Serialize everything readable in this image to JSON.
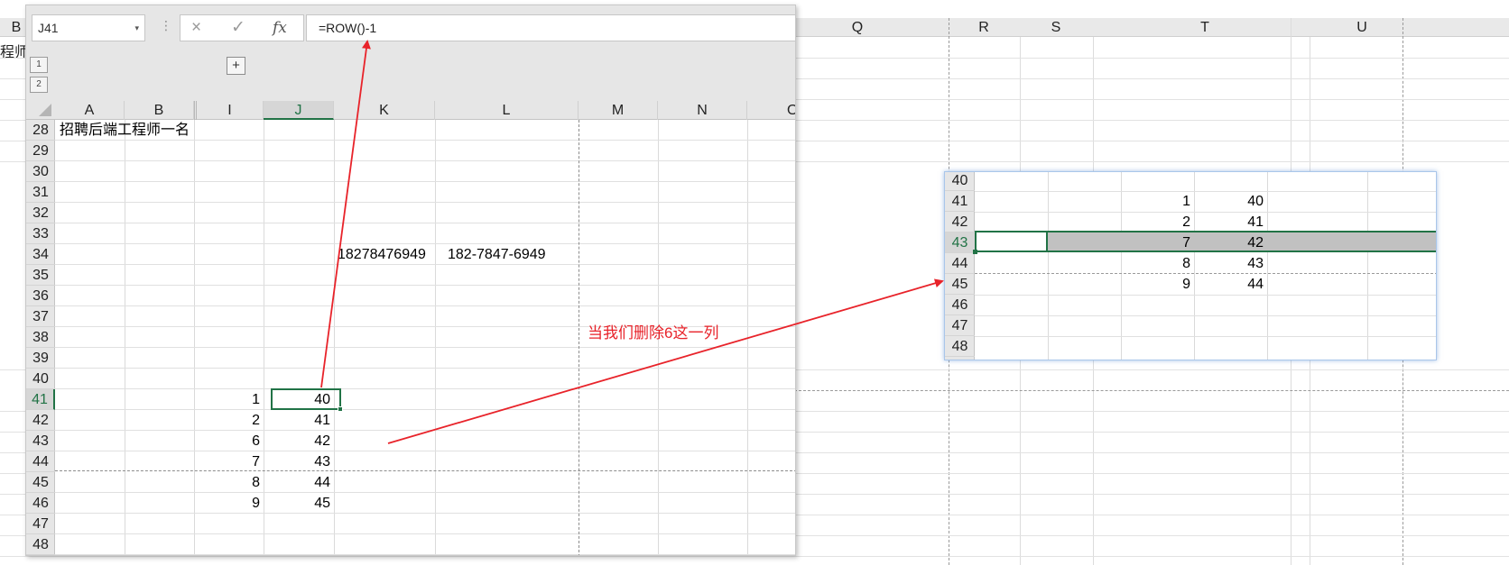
{
  "background_sheet": {
    "col_labels": [
      "B",
      "Q",
      "R",
      "S",
      "T",
      "U"
    ],
    "left_text": "程师"
  },
  "window": {
    "name_box": "J41",
    "formula": "=ROW()-1",
    "icons": {
      "cancel": "×",
      "enter": "✓",
      "fx": "fx",
      "dropdown": "▾",
      "dots": "⋮"
    },
    "outline_levels": [
      "1",
      "2"
    ],
    "expand_button": "+",
    "columns": [
      "A",
      "B",
      "I",
      "J",
      "K",
      "L",
      "M",
      "N",
      "O"
    ],
    "rows": [
      "28",
      "29",
      "30",
      "31",
      "32",
      "33",
      "34",
      "35",
      "36",
      "37",
      "38",
      "39",
      "40",
      "41",
      "42",
      "43",
      "44",
      "45",
      "46",
      "47",
      "48"
    ],
    "cells": {
      "a28": "招聘后端工程师一名",
      "k34": "18278476949",
      "l34": "182-7847-6949",
      "i": [
        "1",
        "2",
        "6",
        "7",
        "8",
        "9"
      ],
      "j": [
        "40",
        "41",
        "42",
        "43",
        "44",
        "45"
      ]
    }
  },
  "popup": {
    "rows": [
      "40",
      "41",
      "42",
      "43",
      "44",
      "45",
      "46",
      "47",
      "48"
    ],
    "col_a": [
      "1",
      "2",
      "7",
      "8",
      "9"
    ],
    "col_b": [
      "40",
      "41",
      "42",
      "43",
      "44"
    ]
  },
  "annotation": {
    "text": "当我们删除6这一列",
    "color": "#e8232a"
  }
}
